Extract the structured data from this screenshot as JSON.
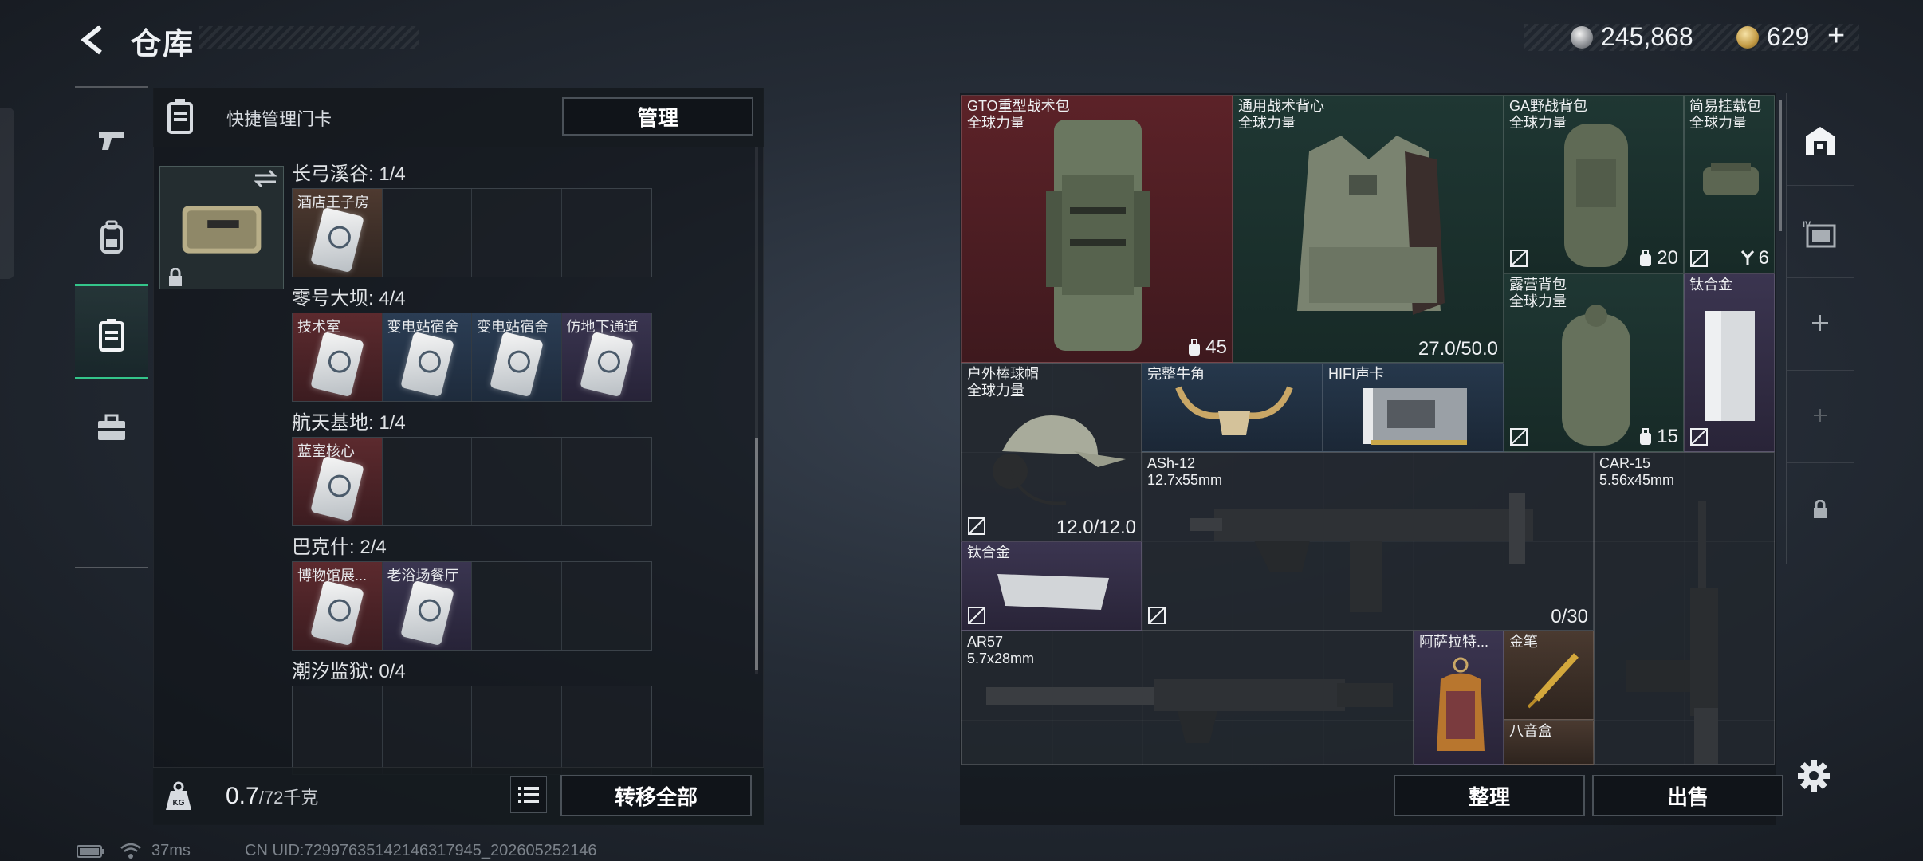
{
  "header": {
    "title": "仓库",
    "silver": "245,868",
    "gold": "629",
    "add": "+"
  },
  "left_tabs": [
    "gun-tab",
    "backpack-tab",
    "keycard-tab",
    "toolbox-tab"
  ],
  "keycard_panel": {
    "header_label": "快捷管理门卡",
    "manage_label": "管理",
    "regions": [
      {
        "title": "长弓溪谷: 1/4",
        "slots": [
          {
            "label": "酒店王子房",
            "rarity": "brown",
            "filled": true
          },
          {
            "filled": false
          },
          {
            "filled": false
          },
          {
            "filled": false
          }
        ]
      },
      {
        "title": "零号大坝: 4/4",
        "slots": [
          {
            "label": "技术室",
            "rarity": "red",
            "filled": true
          },
          {
            "label": "变电站宿舍",
            "rarity": "blue",
            "filled": true
          },
          {
            "label": "变电站宿舍",
            "rarity": "blue",
            "filled": true
          },
          {
            "label": "仿地下通道",
            "rarity": "purple",
            "filled": true
          }
        ]
      },
      {
        "title": "航天基地: 1/4",
        "slots": [
          {
            "label": "蓝室核心",
            "rarity": "red",
            "filled": true
          },
          {
            "filled": false
          },
          {
            "filled": false
          },
          {
            "filled": false
          }
        ]
      },
      {
        "title": "巴克什: 2/4",
        "slots": [
          {
            "label": "博物馆展...",
            "rarity": "red",
            "filled": true
          },
          {
            "label": "老浴场餐厅",
            "rarity": "purple",
            "filled": true
          },
          {
            "filled": false
          },
          {
            "filled": false
          }
        ]
      },
      {
        "title": "潮汐监狱: 0/4",
        "slots": [
          {
            "filled": false
          },
          {
            "filled": false
          },
          {
            "filled": false
          },
          {
            "filled": false
          }
        ]
      }
    ],
    "weight_value": "0.7",
    "weight_unit": "/72千克",
    "transfer_all_label": "转移全部"
  },
  "inventory": {
    "items": [
      {
        "name": "GTO重型战术包",
        "sub": "全球力量",
        "rarity": "red",
        "count": "45",
        "count_icon": "capacity"
      },
      {
        "name": "通用战术背心",
        "sub": "全球力量",
        "rarity": "green",
        "value": "27.0/50.0"
      },
      {
        "name": "GA野战背包",
        "sub": "全球力量",
        "rarity": "green",
        "count": "20",
        "count_icon": "capacity"
      },
      {
        "name": "简易挂载包",
        "sub": "全球力量",
        "rarity": "green",
        "count": "6",
        "count_icon": "hanger"
      },
      {
        "name": "露营背包",
        "sub": "全球力量",
        "rarity": "green",
        "count": "15",
        "count_icon": "capacity"
      },
      {
        "name": "钛合金",
        "rarity": "purple"
      },
      {
        "name": "户外棒球帽",
        "sub": "全球力量",
        "rarity": "gray",
        "value": "12.0/12.0"
      },
      {
        "name": "完整牛角",
        "rarity": "blue"
      },
      {
        "name": "HIFI声卡",
        "rarity": "blue"
      },
      {
        "name": "ASh-12",
        "sub": "12.7x55mm",
        "rarity": "gray",
        "value": "0/30"
      },
      {
        "name": "CAR-15",
        "sub": "5.56x45mm",
        "rarity": "gray"
      },
      {
        "name": "钛合金",
        "rarity": "purple"
      },
      {
        "name": "AR57",
        "sub": "5.7x28mm",
        "rarity": "gray"
      },
      {
        "name": "阿萨拉特...",
        "rarity": "purple"
      },
      {
        "name": "金笔",
        "rarity": "brown"
      },
      {
        "name": "八音盒",
        "rarity": "brown"
      }
    ],
    "sort_label": "整理",
    "sell_label": "出售"
  },
  "status": {
    "ping": "37ms",
    "uid": "CN UID:72997635142146317945_202605252146"
  }
}
